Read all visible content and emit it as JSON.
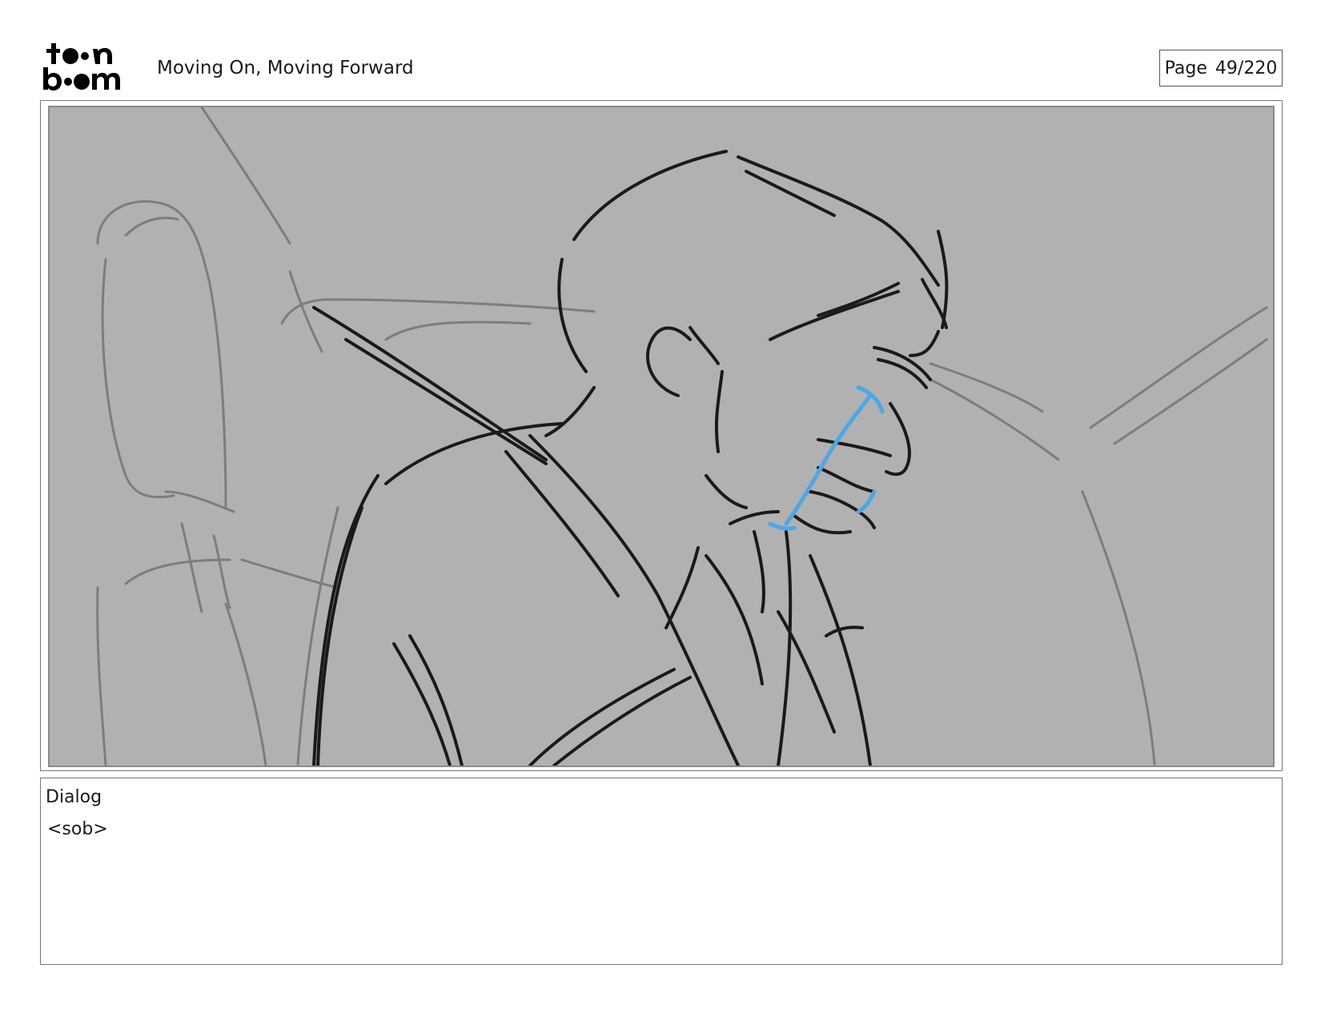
{
  "header": {
    "logo_text": "toonboom",
    "title": "Moving On, Moving Forward",
    "page_label": "Page",
    "page_number": "49/220"
  },
  "panel": {
    "background_color": "#b1b1b1",
    "line_color": "#1a1a1a",
    "sketch_color": "#7d7d7d",
    "tear_color": "#4aa8e8"
  },
  "dialog": {
    "label": "Dialog",
    "text": "<sob>"
  }
}
